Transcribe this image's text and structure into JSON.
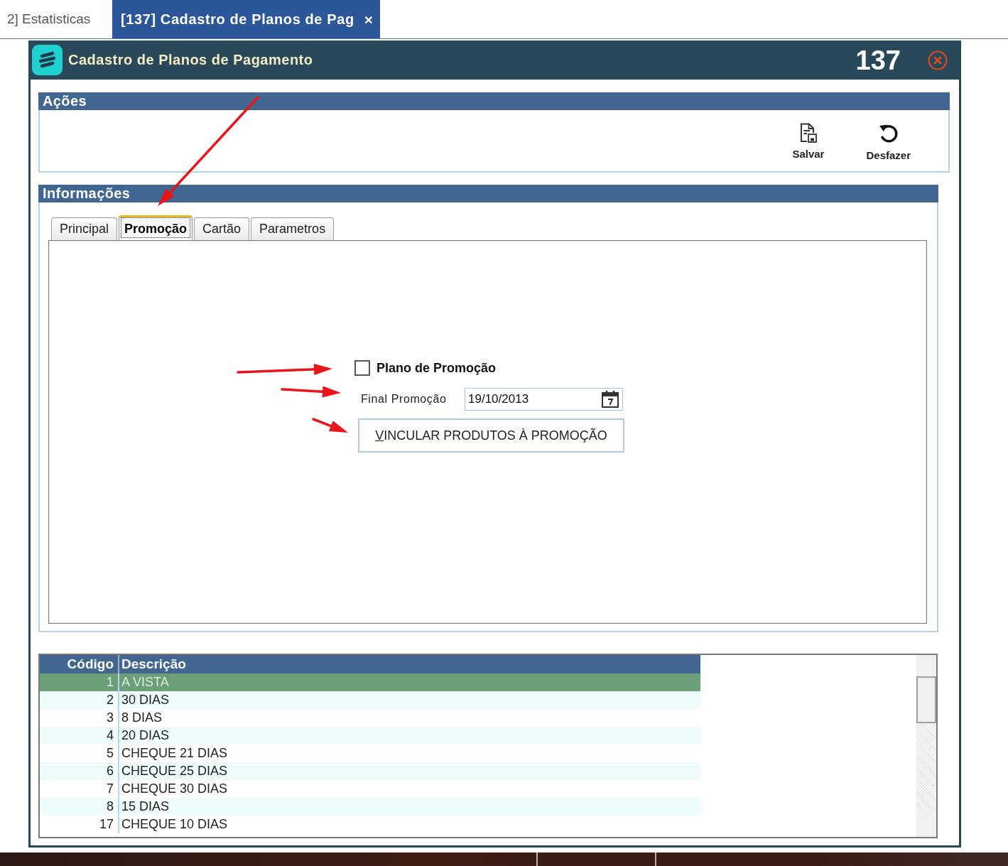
{
  "app_tabs": [
    {
      "label": "2] Estatisticas",
      "selected": false
    },
    {
      "label": "[137] Cadastro de Planos de Pag",
      "selected": true,
      "close": "×"
    }
  ],
  "window": {
    "title": "Cadastro de Planos de Pagamento",
    "number": "137"
  },
  "actions": {
    "title": "Ações",
    "buttons": [
      {
        "label": "Salvar",
        "kind": "save"
      },
      {
        "label": "Desfazer",
        "kind": "undo"
      }
    ]
  },
  "info": {
    "title": "Informações",
    "tabs": [
      {
        "label": "Principal",
        "selected": false
      },
      {
        "label": "Promoção",
        "selected": true
      },
      {
        "label": "Cartão",
        "selected": false
      },
      {
        "label": "Parametros",
        "selected": false
      }
    ],
    "promo_plan": {
      "label": "Plano de Promoção",
      "checked": false
    },
    "promo_end": {
      "label": "Final Promoção",
      "value": "19/10/2013"
    },
    "link_button": {
      "label": "VINCULAR PRODUTOS À PROMOÇÃO"
    }
  },
  "table": {
    "columns": [
      "Código",
      "Descrição"
    ],
    "rows": [
      {
        "code": "1",
        "description": "A VISTA",
        "selected": true
      },
      {
        "code": "2",
        "description": "30 DIAS",
        "selected": false
      },
      {
        "code": "3",
        "description": "8 DIAS",
        "selected": false
      },
      {
        "code": "4",
        "description": "20 DIAS",
        "selected": false
      },
      {
        "code": "5",
        "description": "CHEQUE 21 DIAS",
        "selected": false
      },
      {
        "code": "6",
        "description": "CHEQUE 25 DIAS",
        "selected": false
      },
      {
        "code": "7",
        "description": "CHEQUE 30 DIAS",
        "selected": false
      },
      {
        "code": "8",
        "description": "15 DIAS",
        "selected": false
      },
      {
        "code": "17",
        "description": "CHEQUE 10 DIAS",
        "selected": false
      }
    ]
  }
}
